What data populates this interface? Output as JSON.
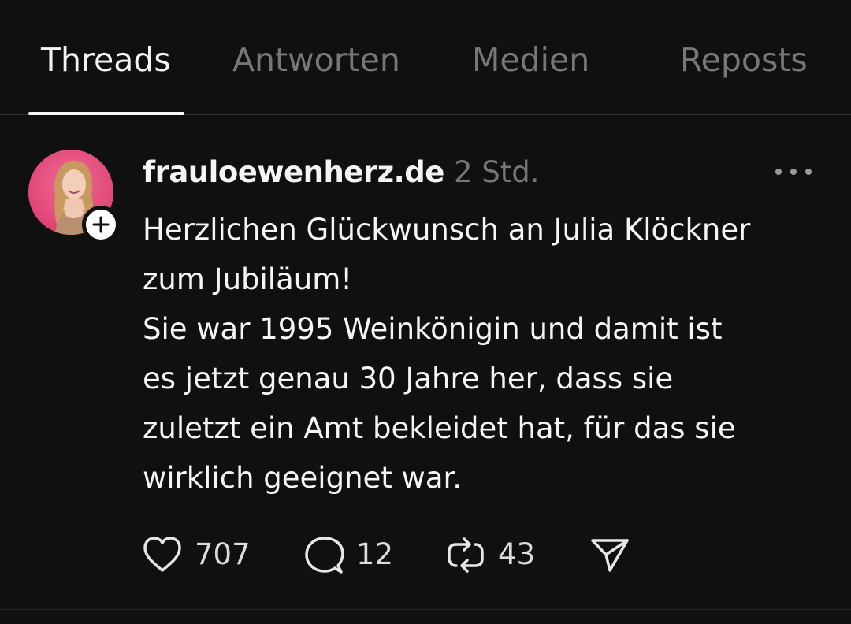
{
  "tabs": [
    {
      "label": "Threads",
      "active": true
    },
    {
      "label": "Antworten",
      "active": false
    },
    {
      "label": "Medien",
      "active": false
    },
    {
      "label": "Reposts",
      "active": false
    }
  ],
  "post": {
    "username": "frauloewenherz.de",
    "timestamp": "2 Std.",
    "text": "Herzlichen Glückwunsch an Julia Klöckner\nzum Jubiläum!\nSie war 1995 Weinkönigin und damit ist\nes jetzt genau 30 Jahre her, dass sie\nzuletzt ein Amt bekleidet hat, für das sie\nwirklich geeignet war.",
    "likes": "707",
    "replies": "12",
    "reposts": "43"
  },
  "icons": {
    "like": "heart-icon",
    "reply": "speech-bubble-icon",
    "repost": "repost-arrows-icon",
    "share": "paper-plane-icon",
    "more": "ellipsis-icon",
    "follow": "plus-icon"
  },
  "colors": {
    "background": "#101010",
    "primary_text": "#f3f5f7",
    "secondary_text": "#777777",
    "avatar_bg": "#e94a7e"
  }
}
